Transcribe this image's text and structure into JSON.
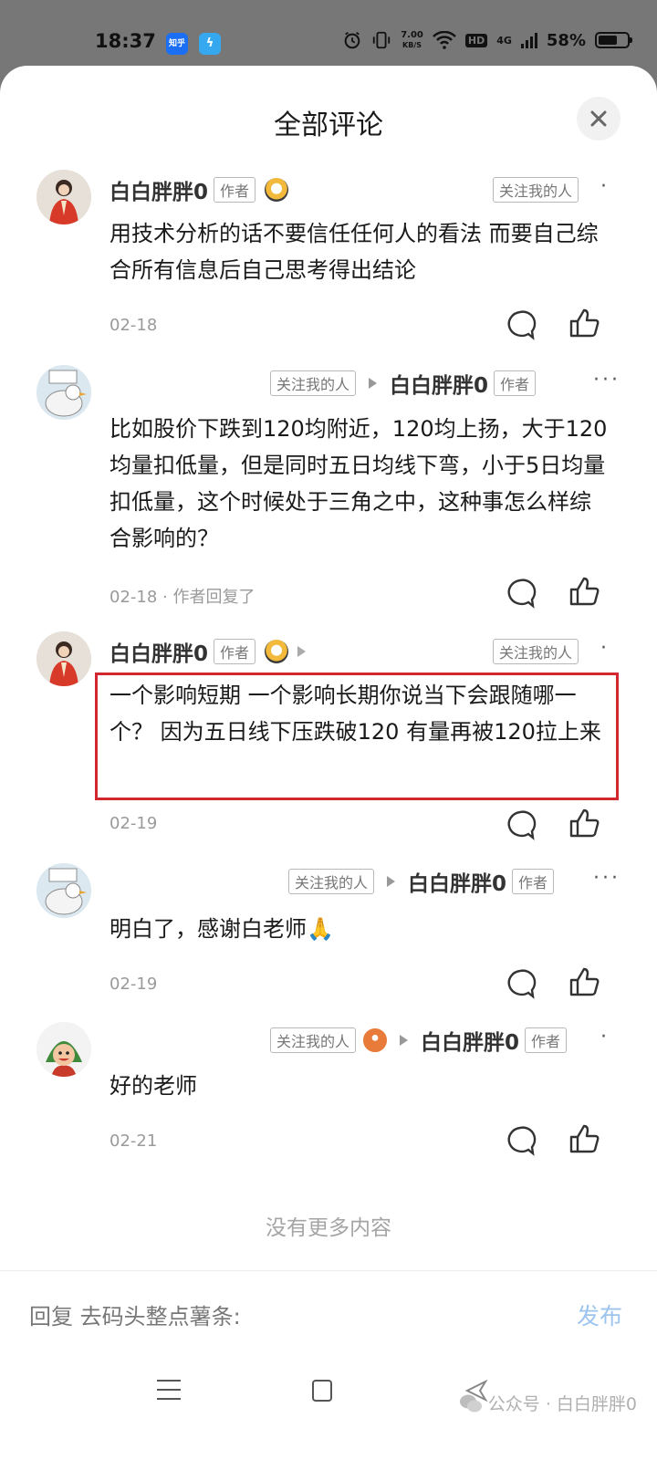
{
  "status_bar": {
    "time": "18:37",
    "app_icon_1": "知乎",
    "speed_value": "7.00",
    "speed_unit": "KB/S",
    "hd": "HD",
    "signal": "4G",
    "battery": "58%"
  },
  "sheet": {
    "title": "全部评论",
    "close_icon": "close-icon"
  },
  "comments": [
    {
      "author": "白白胖胖0",
      "author_badge": "作者",
      "follow_badge": "关注我的人",
      "text": "用技术分析的话不要信任任何人的看法 而要自己综合所有信息后自己思考得出结论",
      "date": "02-18"
    },
    {
      "follow_badge": "关注我的人",
      "reply_to": "白白胖胖0",
      "author_badge": "作者",
      "text": "比如股价下跌到120均附近，120均上扬，大于120均量扣低量，但是同时五日均线下弯，小于5日均量扣低量，这个时候处于三角之中，这种事怎么样综合影响的？",
      "date": "02-18",
      "meta_extra": " · 作者回复了"
    },
    {
      "author": "白白胖胖0",
      "author_badge": "作者",
      "follow_badge": "关注我的人",
      "text": "一个影响短期 一个影响长期你说当下会跟随哪一个？ 因为五日线下压跌破120 有量再被120拉上来",
      "date": "02-19"
    },
    {
      "follow_badge": "关注我的人",
      "reply_to": "白白胖胖0",
      "author_badge": "作者",
      "text": "明白了，感谢白老师🙏",
      "date": "02-19"
    },
    {
      "follow_badge": "关注我的人",
      "reply_to": "白白胖胖0",
      "author_badge": "作者",
      "text": "好的老师",
      "date": "02-21"
    }
  ],
  "footer": {
    "no_more": "没有更多内容",
    "reply_placeholder": "回复 去码头整点薯条:",
    "send_label": "发布",
    "watermark": "公众号 · 白白胖胖0"
  },
  "colors": {
    "highlight_border": "#d3272f",
    "send_button": "#9cc4ee",
    "zhihu_blue": "#1a6ff5"
  }
}
